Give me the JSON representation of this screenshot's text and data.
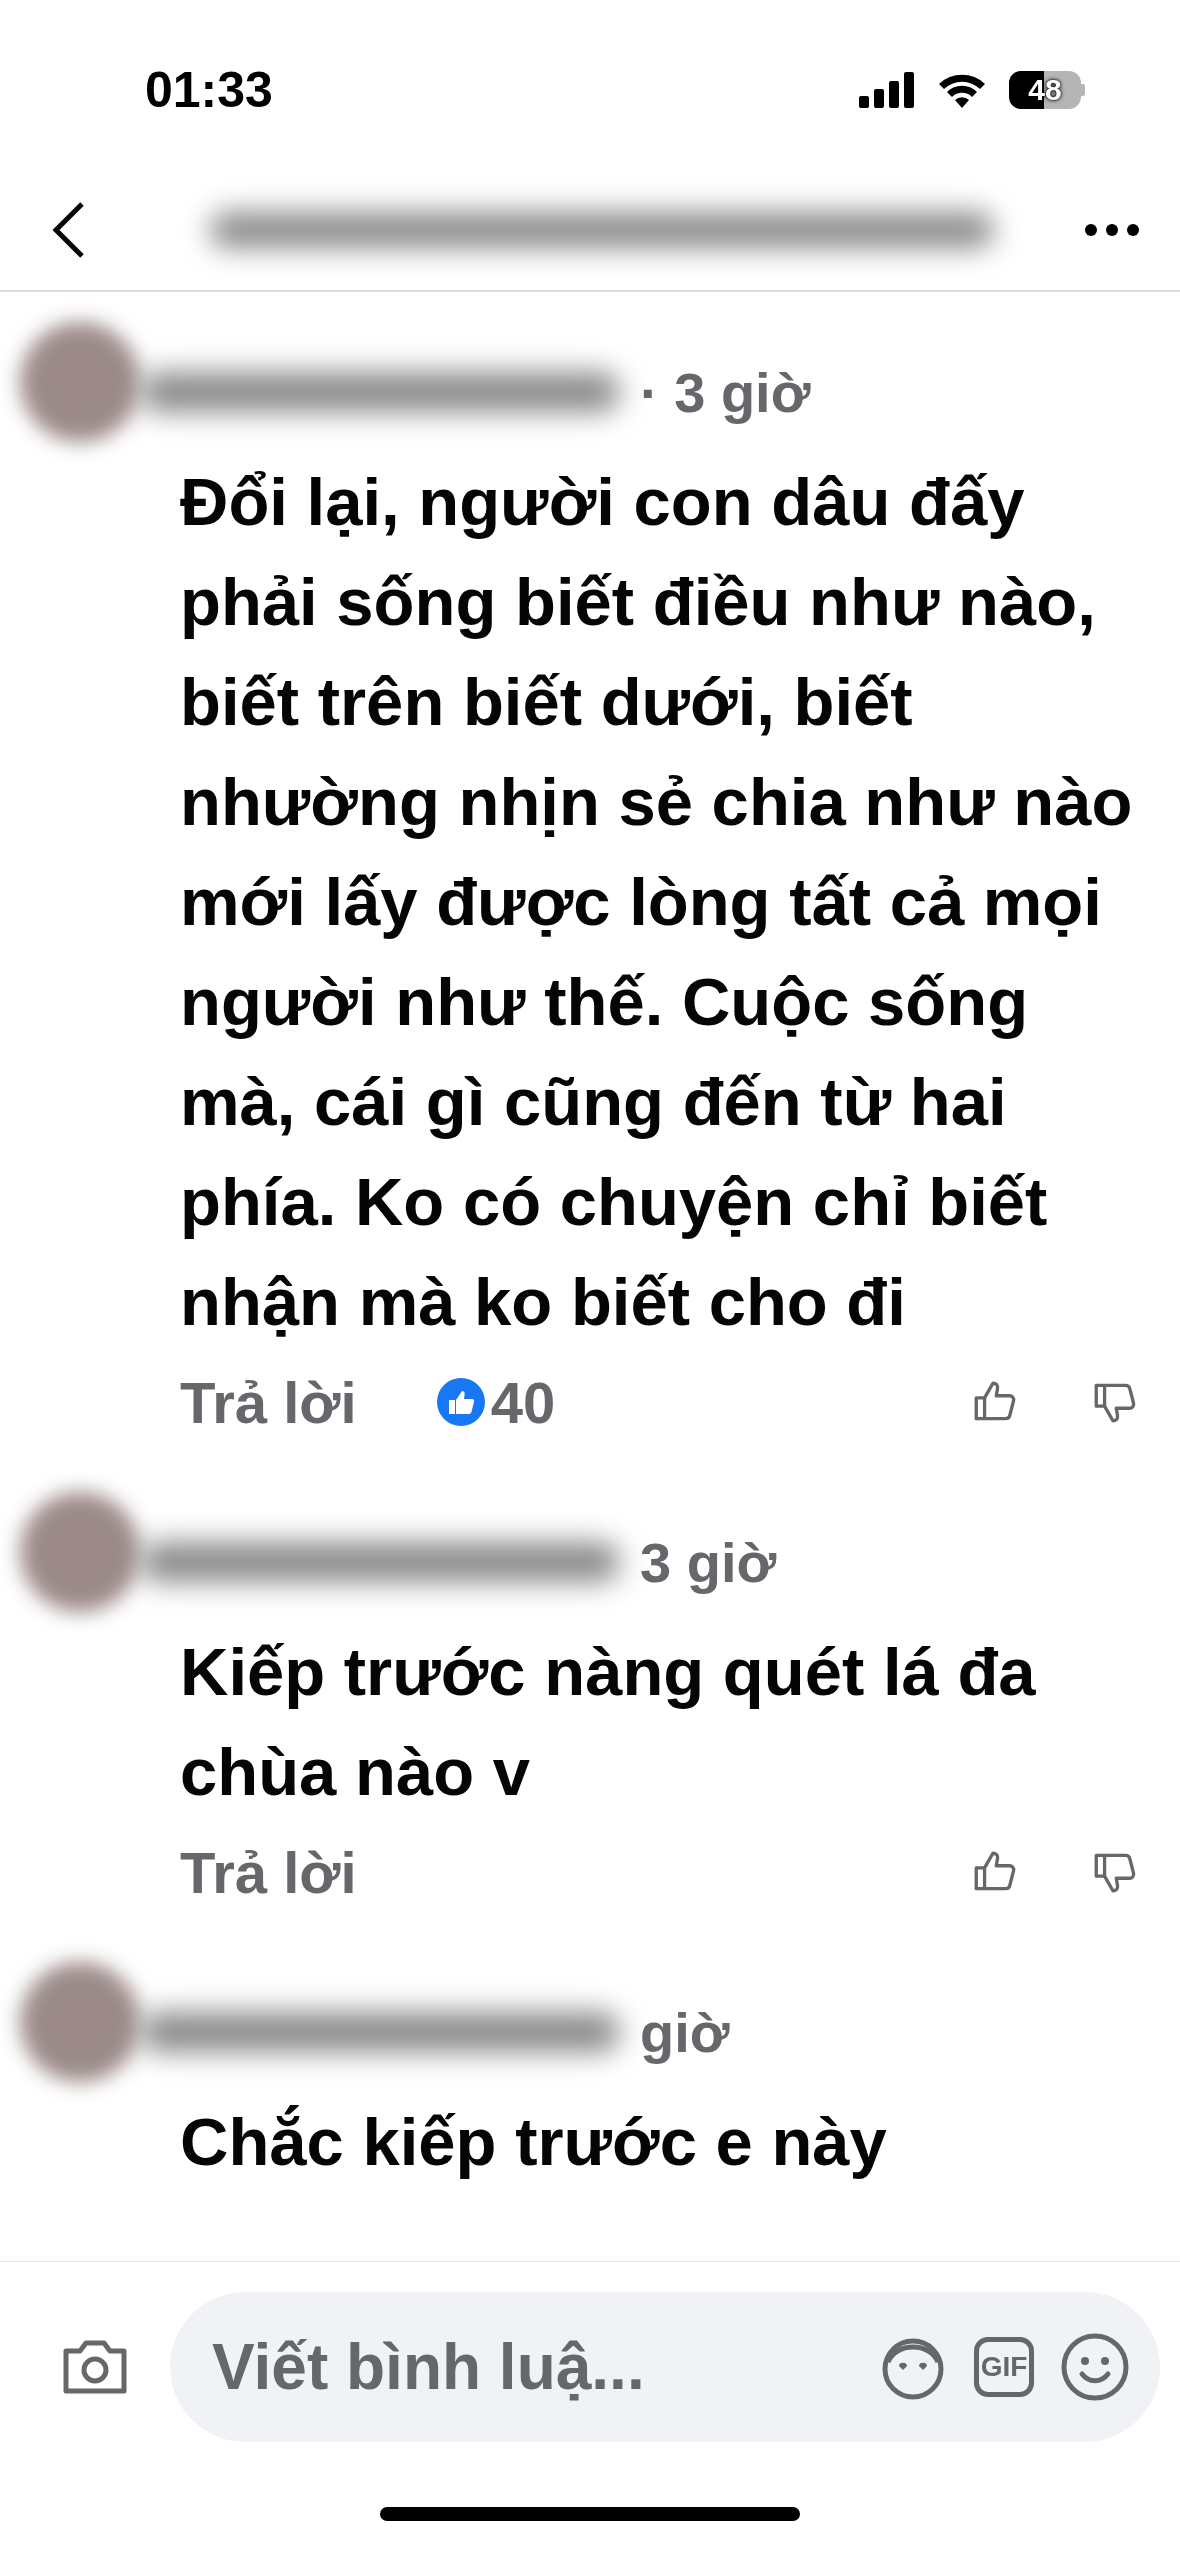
{
  "status_bar": {
    "time": "01:33",
    "battery": "48"
  },
  "comments": [
    {
      "time": "· 3 giờ",
      "text": "Đổi lại, người con dâu đấy phải sống biết điều như nào, biết trên biết dưới, biết nhường nhịn sẻ chia như nào mới lấy được lòng tất cả mọi người như thế. Cuộc sống mà, cái gì cũng đến từ hai phía. Ko có chuyện chỉ biết nhận mà ko biết cho đi",
      "reply": "Trả lời",
      "likes": "40"
    },
    {
      "time": "3 giờ",
      "text": "Kiếp trước nàng quét lá đa chùa nào v",
      "reply": "Trả lời"
    },
    {
      "time": "giờ",
      "text": "Chắc kiếp trước e này"
    }
  ],
  "composer": {
    "placeholder": "Viết bình luậ...",
    "gif_label": "GIF"
  }
}
